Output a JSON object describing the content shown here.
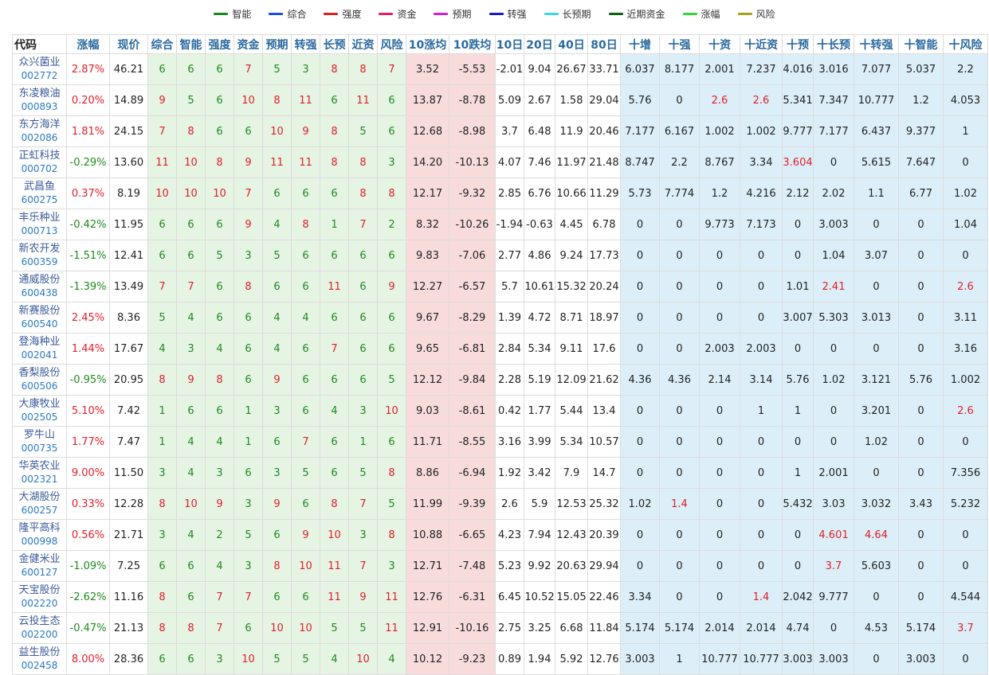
{
  "legend": [
    {
      "label": "智能",
      "color": "#1a8a1a"
    },
    {
      "label": "综合",
      "color": "#1c4fd6"
    },
    {
      "label": "强度",
      "color": "#e02020"
    },
    {
      "label": "资金",
      "color": "#e0206a"
    },
    {
      "label": "预期",
      "color": "#d020d0"
    },
    {
      "label": "转强",
      "color": "#1a1ab8"
    },
    {
      "label": "长预期",
      "color": "#3ad8e0"
    },
    {
      "label": "近期资金",
      "color": "#166016"
    },
    {
      "label": "涨幅",
      "color": "#34d834"
    },
    {
      "label": "风险",
      "color": "#a8a020"
    }
  ],
  "headers": [
    "代码",
    "涨幅",
    "现价",
    "综合",
    "智能",
    "强度",
    "资金",
    "预期",
    "转强",
    "长预",
    "近资",
    "风险",
    "10涨均",
    "10跌均",
    "10日",
    "20日",
    "40日",
    "80日",
    "十增",
    "十强",
    "十资",
    "十近资",
    "十预",
    "十长预",
    "十转强",
    "十智能",
    "十风险"
  ],
  "chart_data": {
    "type": "table",
    "columns": [
      "代码",
      "涨幅",
      "现价",
      "综合",
      "智能",
      "强度",
      "资金",
      "预期",
      "转强",
      "长预",
      "近资",
      "风险",
      "10涨均",
      "10跌均",
      "10日",
      "20日",
      "40日",
      "80日",
      "十增",
      "十强",
      "十资",
      "十近资",
      "十预",
      "十长预",
      "十转强",
      "十智能",
      "十风险"
    ],
    "rows": [
      {
        "name": "众兴菌业",
        "code": "002772",
        "cells": [
          "2.87%",
          "46.21",
          "6",
          "6",
          "6",
          "7",
          "5",
          "3",
          "8",
          "8",
          "7",
          "3.52",
          "-5.53",
          "-2.01",
          "9.04",
          "26.67",
          "33.71",
          "6.037",
          "8.177",
          "2.001",
          "7.237",
          "4.016",
          "3.016",
          "7.077",
          "5.037",
          "2.2"
        ]
      },
      {
        "name": "东凌粮油",
        "code": "000893",
        "cells": [
          "0.20%",
          "14.89",
          "9",
          "5",
          "6",
          "10",
          "8",
          "11",
          "6",
          "11",
          "6",
          "13.87",
          "-8.78",
          "5.09",
          "2.67",
          "1.58",
          "29.04",
          "5.76",
          "0",
          "2.6",
          "2.6",
          "5.341",
          "7.347",
          "10.777",
          "1.2",
          "4.053"
        ]
      },
      {
        "name": "东方海洋",
        "code": "002086",
        "cells": [
          "1.81%",
          "24.15",
          "7",
          "8",
          "6",
          "6",
          "10",
          "9",
          "8",
          "5",
          "6",
          "12.68",
          "-8.98",
          "3.7",
          "6.48",
          "11.9",
          "20.46",
          "7.177",
          "6.167",
          "1.002",
          "1.002",
          "9.777",
          "7.177",
          "6.437",
          "9.377",
          "1"
        ]
      },
      {
        "name": "正虹科技",
        "code": "000702",
        "cells": [
          "-0.29%",
          "13.60",
          "11",
          "10",
          "8",
          "9",
          "11",
          "11",
          "8",
          "8",
          "3",
          "14.20",
          "-10.13",
          "4.07",
          "7.46",
          "11.97",
          "21.48",
          "8.747",
          "2.2",
          "8.767",
          "3.34",
          "3.604",
          "0",
          "5.615",
          "7.647",
          "0"
        ]
      },
      {
        "name": "武昌鱼",
        "code": "600275",
        "cells": [
          "0.37%",
          "8.19",
          "10",
          "10",
          "10",
          "7",
          "6",
          "6",
          "6",
          "8",
          "8",
          "12.17",
          "-9.32",
          "2.85",
          "6.76",
          "10.66",
          "11.29",
          "5.73",
          "7.774",
          "1.2",
          "4.216",
          "2.12",
          "2.02",
          "1.1",
          "6.77",
          "1.02"
        ]
      },
      {
        "name": "丰乐种业",
        "code": "000713",
        "cells": [
          "-0.42%",
          "11.95",
          "6",
          "6",
          "6",
          "9",
          "4",
          "8",
          "1",
          "7",
          "2",
          "8.32",
          "-10.26",
          "-1.94",
          "-0.63",
          "4.45",
          "6.78",
          "0",
          "0",
          "9.773",
          "7.173",
          "0",
          "3.003",
          "0",
          "0",
          "1.04"
        ]
      },
      {
        "name": "新农开发",
        "code": "600359",
        "cells": [
          "-1.51%",
          "12.41",
          "6",
          "6",
          "5",
          "3",
          "5",
          "6",
          "6",
          "6",
          "6",
          "9.83",
          "-7.06",
          "2.77",
          "4.86",
          "9.24",
          "17.73",
          "0",
          "0",
          "0",
          "0",
          "0",
          "1.04",
          "3.07",
          "0",
          "0"
        ]
      },
      {
        "name": "通威股份",
        "code": "600438",
        "cells": [
          "-1.39%",
          "13.49",
          "7",
          "7",
          "6",
          "8",
          "6",
          "6",
          "11",
          "6",
          "9",
          "12.27",
          "-6.57",
          "5.7",
          "10.61",
          "15.32",
          "20.24",
          "0",
          "0",
          "0",
          "0",
          "1.01",
          "2.41",
          "0",
          "0",
          "2.6"
        ]
      },
      {
        "name": "新赛股份",
        "code": "600540",
        "cells": [
          "2.45%",
          "8.36",
          "5",
          "4",
          "6",
          "6",
          "4",
          "4",
          "6",
          "6",
          "6",
          "9.67",
          "-8.29",
          "1.39",
          "4.72",
          "8.71",
          "18.97",
          "0",
          "0",
          "0",
          "0",
          "3.007",
          "5.303",
          "3.013",
          "0",
          "3.11"
        ]
      },
      {
        "name": "登海种业",
        "code": "002041",
        "cells": [
          "1.44%",
          "17.67",
          "4",
          "3",
          "4",
          "6",
          "4",
          "6",
          "7",
          "6",
          "6",
          "9.65",
          "-6.81",
          "2.84",
          "5.34",
          "9.11",
          "17.6",
          "0",
          "0",
          "2.003",
          "2.003",
          "0",
          "0",
          "0",
          "0",
          "3.16"
        ]
      },
      {
        "name": "香梨股份",
        "code": "600506",
        "cells": [
          "-0.95%",
          "20.95",
          "8",
          "9",
          "8",
          "6",
          "9",
          "6",
          "6",
          "6",
          "5",
          "12.12",
          "-9.84",
          "2.28",
          "5.19",
          "12.09",
          "21.62",
          "4.36",
          "4.36",
          "2.14",
          "3.14",
          "5.76",
          "1.02",
          "3.121",
          "5.76",
          "1.002"
        ]
      },
      {
        "name": "大康牧业",
        "code": "002505",
        "cells": [
          "5.10%",
          "7.42",
          "1",
          "6",
          "6",
          "1",
          "3",
          "6",
          "4",
          "3",
          "10",
          "9.03",
          "-8.61",
          "0.42",
          "1.77",
          "5.44",
          "13.4",
          "0",
          "0",
          "0",
          "1",
          "1",
          "0",
          "3.201",
          "0",
          "2.6"
        ]
      },
      {
        "name": "罗牛山",
        "code": "000735",
        "cells": [
          "1.77%",
          "7.47",
          "1",
          "4",
          "4",
          "1",
          "6",
          "7",
          "6",
          "1",
          "6",
          "11.71",
          "-8.55",
          "3.16",
          "3.99",
          "5.34",
          "10.57",
          "0",
          "0",
          "0",
          "0",
          "0",
          "0",
          "1.02",
          "0",
          "0"
        ]
      },
      {
        "name": "华英农业",
        "code": "002321",
        "cells": [
          "9.00%",
          "11.50",
          "3",
          "4",
          "3",
          "6",
          "3",
          "5",
          "6",
          "5",
          "8",
          "8.86",
          "-6.94",
          "1.92",
          "3.42",
          "7.9",
          "14.7",
          "0",
          "0",
          "0",
          "0",
          "1",
          "2.001",
          "0",
          "0",
          "7.356"
        ]
      },
      {
        "name": "大湖股份",
        "code": "600257",
        "cells": [
          "0.33%",
          "12.28",
          "8",
          "10",
          "9",
          "3",
          "9",
          "6",
          "8",
          "7",
          "5",
          "11.99",
          "-9.39",
          "2.6",
          "5.9",
          "12.53",
          "25.32",
          "1.02",
          "1.4",
          "0",
          "0",
          "5.432",
          "3.03",
          "3.032",
          "3.43",
          "5.232"
        ]
      },
      {
        "name": "隆平高科",
        "code": "000998",
        "cells": [
          "0.56%",
          "21.71",
          "3",
          "4",
          "2",
          "5",
          "6",
          "9",
          "10",
          "3",
          "8",
          "10.88",
          "-6.65",
          "4.23",
          "7.94",
          "12.43",
          "20.39",
          "0",
          "0",
          "0",
          "0",
          "0",
          "4.601",
          "4.64",
          "0",
          "0"
        ]
      },
      {
        "name": "金健米业",
        "code": "600127",
        "cells": [
          "-1.09%",
          "7.25",
          "6",
          "6",
          "4",
          "3",
          "8",
          "10",
          "11",
          "7",
          "3",
          "12.71",
          "-7.48",
          "5.23",
          "9.92",
          "20.63",
          "29.94",
          "0",
          "0",
          "0",
          "0",
          "0",
          "3.7",
          "5.603",
          "0",
          "0"
        ]
      },
      {
        "name": "天宝股份",
        "code": "002220",
        "cells": [
          "-2.62%",
          "11.16",
          "8",
          "6",
          "7",
          "7",
          "6",
          "6",
          "11",
          "9",
          "11",
          "12.76",
          "-6.31",
          "6.45",
          "10.52",
          "15.05",
          "22.46",
          "3.34",
          "0",
          "0",
          "1.4",
          "2.042",
          "9.777",
          "0",
          "0",
          "4.544"
        ]
      },
      {
        "name": "云投生态",
        "code": "002200",
        "cells": [
          "-0.47%",
          "21.13",
          "8",
          "8",
          "7",
          "6",
          "10",
          "10",
          "5",
          "5",
          "11",
          "12.91",
          "-10.16",
          "2.75",
          "3.25",
          "6.68",
          "11.84",
          "5.174",
          "5.174",
          "2.014",
          "2.014",
          "4.74",
          "0",
          "4.53",
          "5.174",
          "3.7"
        ]
      },
      {
        "name": "益生股份",
        "code": "002458",
        "cells": [
          "8.00%",
          "28.36",
          "6",
          "6",
          "3",
          "10",
          "5",
          "5",
          "4",
          "10",
          "4",
          "10.12",
          "-9.23",
          "0.89",
          "1.94",
          "5.92",
          "12.76",
          "3.003",
          "1",
          "10.777",
          "10.777",
          "3.003",
          "3.003",
          "0",
          "3.003",
          "0"
        ]
      }
    ]
  }
}
